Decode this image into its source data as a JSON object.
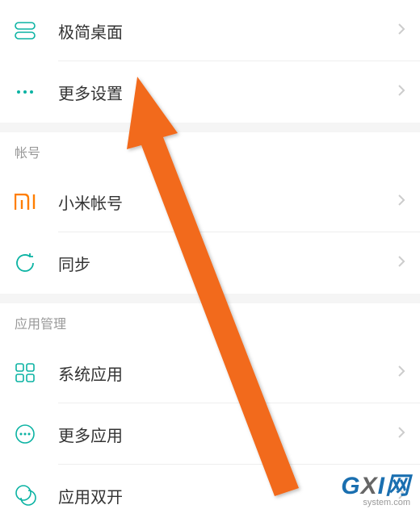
{
  "items": {
    "simple_desktop": {
      "label": "极简桌面"
    },
    "more_settings": {
      "label": "更多设置"
    },
    "mi_account": {
      "label": "小米帐号"
    },
    "sync": {
      "label": "同步"
    },
    "system_apps": {
      "label": "系统应用"
    },
    "more_apps": {
      "label": "更多应用"
    },
    "dual_apps": {
      "label": "应用双开"
    }
  },
  "sections": {
    "account": "帐号",
    "app_mgmt": "应用管理"
  },
  "watermark": {
    "brand_g": "G",
    "brand_x": "X",
    "brand_i": "I",
    "brand_net": "网",
    "domain": "system.com"
  },
  "colors": {
    "accent": "#0bb3a3",
    "mi_orange": "#ff7e00",
    "arrow": "#f26a1b"
  }
}
